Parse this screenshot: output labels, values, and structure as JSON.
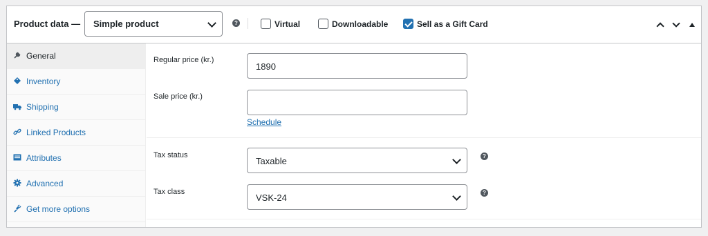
{
  "header": {
    "title": "Product data —",
    "product_type": "Simple product",
    "help_glyph": "?",
    "virtual_label": "Virtual",
    "downloadable_label": "Downloadable",
    "giftcard_label": "Sell as a Gift Card",
    "virtual_checked": false,
    "downloadable_checked": false,
    "giftcard_checked": true
  },
  "sidebar": {
    "items": [
      {
        "label": "General",
        "icon": "wrench-icon",
        "active": true
      },
      {
        "label": "Inventory",
        "icon": "tag-icon",
        "active": false
      },
      {
        "label": "Shipping",
        "icon": "truck-icon",
        "active": false
      },
      {
        "label": "Linked Products",
        "icon": "link-icon",
        "active": false
      },
      {
        "label": "Attributes",
        "icon": "list-icon",
        "active": false
      },
      {
        "label": "Advanced",
        "icon": "gear-icon",
        "active": false
      },
      {
        "label": "Get more options",
        "icon": "plugin-icon",
        "active": false
      }
    ]
  },
  "general": {
    "regular_price_label": "Regular price (kr.)",
    "regular_price_value": "1890",
    "sale_price_label": "Sale price (kr.)",
    "sale_price_value": "",
    "schedule_link": "Schedule",
    "tax_status_label": "Tax status",
    "tax_status_value": "Taxable",
    "tax_class_label": "Tax class",
    "tax_class_value": "VSK-24"
  },
  "colors": {
    "accent": "#2271b1",
    "text": "#1d2327",
    "border": "#c3c4c7"
  }
}
